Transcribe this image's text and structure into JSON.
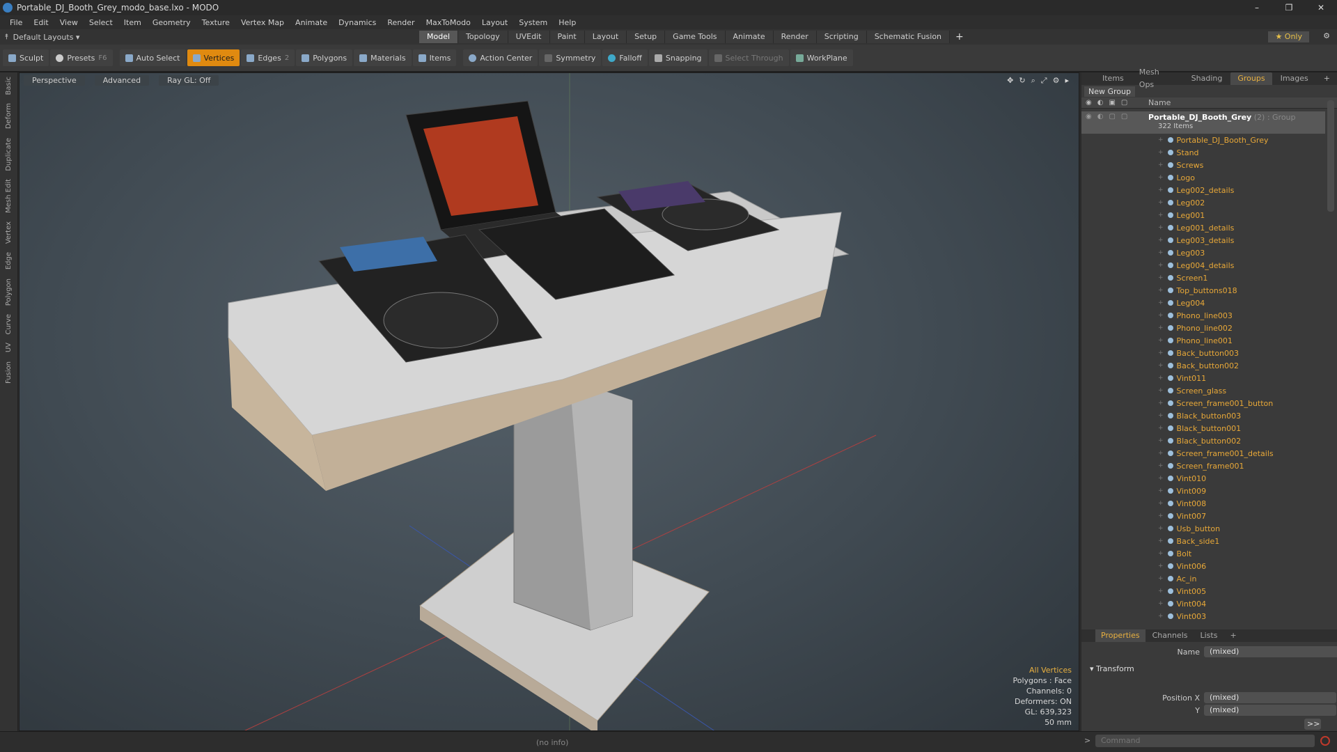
{
  "window": {
    "title": "Portable_DJ_Booth_Grey_modo_base.lxo - MODO",
    "minimize": "–",
    "maximize": "❐",
    "close": "✕"
  },
  "menu": [
    "File",
    "Edit",
    "View",
    "Select",
    "Item",
    "Geometry",
    "Texture",
    "Vertex Map",
    "Animate",
    "Dynamics",
    "Render",
    "MaxToModo",
    "Layout",
    "System",
    "Help"
  ],
  "layoutbar": {
    "layout": "Default Layouts ▾",
    "tabs": [
      "Model",
      "Topology",
      "UVEdit",
      "Paint",
      "Layout",
      "Setup",
      "Game Tools",
      "Animate",
      "Render",
      "Scripting",
      "Schematic Fusion"
    ],
    "active_tab": "Model",
    "only": "★ Only"
  },
  "toolbar": {
    "sculpt": "Sculpt",
    "presets": "Presets",
    "presets_key": "F6",
    "auto_select": "Auto Select",
    "vertices": "Vertices",
    "edges": "Edges",
    "edges_count": "2",
    "polygons": "Polygons",
    "materials": "Materials",
    "items": "Items",
    "action_center": "Action Center",
    "symmetry": "Symmetry",
    "falloff": "Falloff",
    "snapping": "Snapping",
    "select_through": "Select Through",
    "workplane": "WorkPlane"
  },
  "left_tabs": [
    "Basic",
    "Deform",
    "Duplicate",
    "Mesh Edit",
    "Vertex",
    "Edge",
    "Polygon",
    "Curve",
    "UV",
    "Fusion"
  ],
  "viewport": {
    "view": "Perspective",
    "shading": "Advanced",
    "raygl": "Ray GL: Off"
  },
  "stats": {
    "selection": "All Vertices",
    "polygons": "Polygons : Face",
    "channels": "Channels: 0",
    "deformers": "Deformers: ON",
    "gl": "GL: 639,323",
    "focal": "50 mm"
  },
  "right_panel": {
    "tabs": [
      "Items",
      "Mesh Ops",
      "Shading",
      "Groups",
      "Images"
    ],
    "active_tab": "Groups",
    "new_group": "New Group",
    "column_name": "Name",
    "group": {
      "name": "Portable_DJ_Booth_Grey",
      "count": "(2) : Group",
      "items": "322 Items"
    },
    "items": [
      "Portable_DJ_Booth_Grey",
      "Stand",
      "Screws",
      "Logo",
      "Leg002_details",
      "Leg002",
      "Leg001",
      "Leg001_details",
      "Leg003_details",
      "Leg003",
      "Leg004_details",
      "Screen1",
      "Top_buttons018",
      "Leg004",
      "Phono_line003",
      "Phono_line002",
      "Phono_line001",
      "Back_button003",
      "Back_button002",
      "Vint011",
      "Screen_glass",
      "Screen_frame001_button",
      "Black_button003",
      "Black_button001",
      "Black_button002",
      "Screen_frame001_details",
      "Screen_frame001",
      "Vint010",
      "Vint009",
      "Vint008",
      "Vint007",
      "Usb_button",
      "Back_side1",
      "Bolt",
      "Vint006",
      "Ac_in",
      "Vint005",
      "Vint004",
      "Vint003"
    ]
  },
  "properties": {
    "tabs": [
      "Properties",
      "Channels",
      "Lists"
    ],
    "active_tab": "Properties",
    "name_label": "Name",
    "name_value": "(mixed)",
    "transform": "Transform",
    "pos_x_label": "Position X",
    "pos_x": "(mixed)",
    "pos_y_label": "Y",
    "pos_y": "(mixed)",
    "more": ">>"
  },
  "status": {
    "info": "(no info)",
    "command_placeholder": "Command"
  }
}
